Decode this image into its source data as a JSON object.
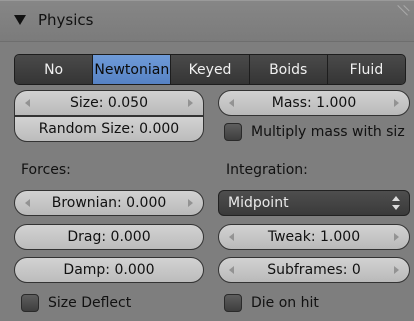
{
  "panel": {
    "title": "Physics"
  },
  "type_tabs": [
    {
      "label": "No",
      "active": false
    },
    {
      "label": "Newtonian",
      "active": true
    },
    {
      "label": "Keyed",
      "active": false
    },
    {
      "label": "Boids",
      "active": false
    },
    {
      "label": "Fluid",
      "active": false
    }
  ],
  "left": {
    "size": "Size: 0.050",
    "random_size": "Random Size: 0.000",
    "forces_label": "Forces:",
    "brownian": "Brownian: 0.000",
    "drag": "Drag: 0.000",
    "damp": "Damp: 0.000",
    "size_deflect": "Size Deflect"
  },
  "right": {
    "mass": "Mass: 1.000",
    "multiply_mass": "Multiply mass with siz",
    "integration_label": "Integration:",
    "integration_value": "Midpoint",
    "tweak": "Tweak: 1.000",
    "subframes": "Subframes: 0",
    "die_on_hit": "Die on hit"
  },
  "colors": {
    "panel_bg": "#7e7e7e",
    "active_tab": "#6f9bd8",
    "field_bg": "#c8c8c8",
    "dark_button": "#3f3f3f"
  }
}
